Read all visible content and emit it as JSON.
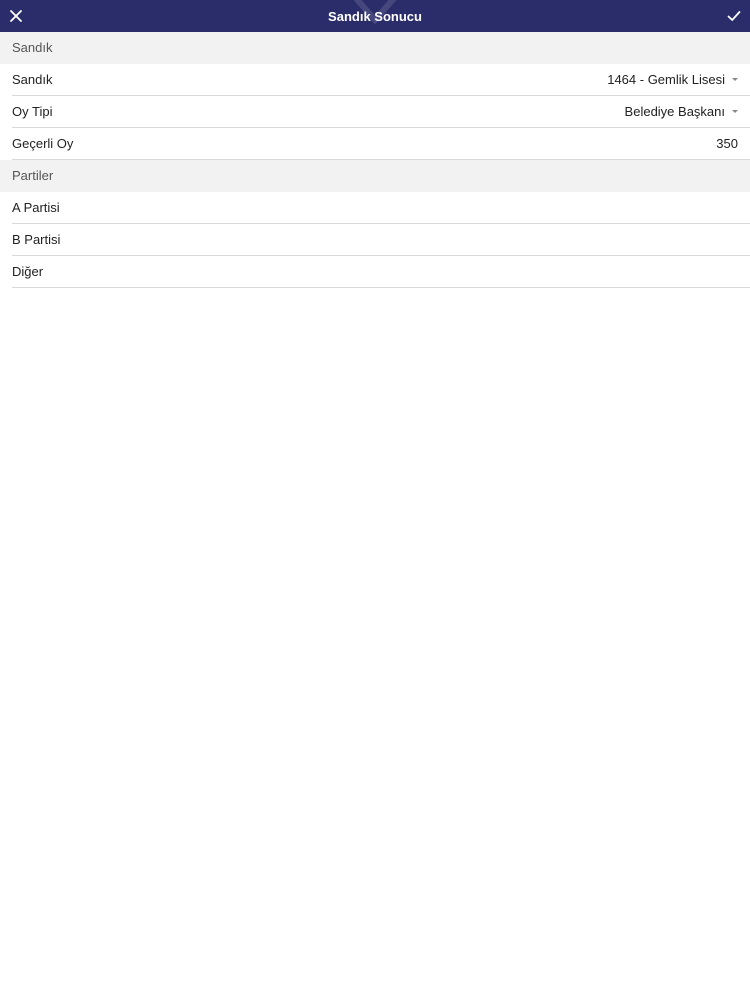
{
  "app_bar": {
    "title": "Sandık Sonucu",
    "close_icon": "close-icon",
    "confirm_icon": "check-icon",
    "background": "#2b2d6b"
  },
  "sections": {
    "sandik": {
      "header": "Sandık",
      "rows": {
        "sandik": {
          "label": "Sandık",
          "value": "1464 - Gemlik Lisesi"
        },
        "oy_tipi": {
          "label": "Oy Tipi",
          "value": "Belediye Başkanı"
        },
        "gecerli_oy": {
          "label": "Geçerli Oy",
          "value": "350"
        }
      }
    },
    "partiler": {
      "header": "Partiler",
      "rows": {
        "a": {
          "label": "A Partisi",
          "value": ""
        },
        "b": {
          "label": "B Partisi",
          "value": ""
        },
        "diger": {
          "label": "Diğer",
          "value": ""
        }
      }
    }
  }
}
